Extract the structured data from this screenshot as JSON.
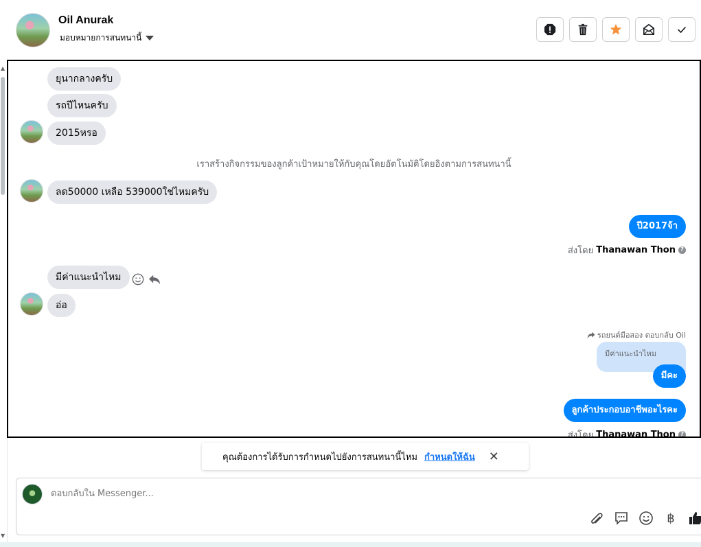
{
  "header": {
    "contact_name": "Oil Anurak",
    "assign_label": "มอบหมายการสนทนานี้",
    "toolbar": {
      "spam": "spam-icon",
      "trash": "trash-icon",
      "star": "star-icon",
      "unread": "mark-unread-icon",
      "done": "check-icon"
    }
  },
  "messages": {
    "m1": "ยุนากลางครับ",
    "m2": "รถปีไหนครับ",
    "m3": "2015หรอ",
    "system_note": "เราสร้างกิจกรรมของลูกค้าเป้าหมายให้กับคุณโดยอัตโนมัติโดยอิงตามการสนทนานี้",
    "m4": "ลด50000 เหลือ 539000ใช่ไหมครับ",
    "out1": "ปี2017จ้า",
    "sent_by_prefix": "ส่งโดย",
    "sent_by_name": "Thanawan Thon",
    "m5": "มีค่าแนะนำไหม",
    "m6": "อ่อ",
    "reply_meta": "รถยนต์มือสอง ตอบกลับ Oil",
    "quoted": "มีค่าแนะนำไหม",
    "out2": "มีคะ",
    "out3": "ลูกค้าประกอบอาชีพอะไรคะ",
    "sent_by_prefix_2": "ส่งโดย",
    "sent_by_name_2": "Thanawan Thon"
  },
  "suggestion": {
    "text": "คุณต้องการได้รับการกำหนดไปยังการสนทนานี้ไหม",
    "link": "กำหนดให้ฉัน"
  },
  "composer": {
    "placeholder": "ตอบกลับใน Messenger...",
    "baht_symbol": "฿"
  },
  "colors": {
    "accent": "#0084ff",
    "star": "#f7923b",
    "incoming_bubble": "#e4e6eb"
  }
}
